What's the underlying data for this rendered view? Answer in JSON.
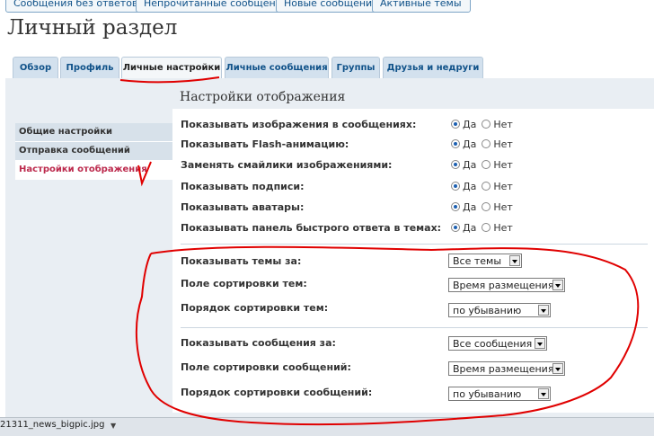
{
  "top_links": [
    "Сообщения без ответов",
    "Непрочитанные сообщения",
    "Новые сообщения",
    "Активные темы"
  ],
  "page_title": "Личный раздел",
  "tabs": [
    "Обзор",
    "Профиль",
    "Личные настройки",
    "Личные сообщения",
    "Группы",
    "Друзья и недруги"
  ],
  "active_tab": "Личные настройки",
  "section_title": "Настройки отображения",
  "side_menu": [
    "Общие настройки",
    "Отправка сообщений",
    "Настройки отображения"
  ],
  "active_side_item": "Настройки отображения",
  "yes_label": "Да",
  "no_label": "Нет",
  "radio_rows": [
    {
      "label": "Показывать изображения в сообщениях:",
      "value": "Да"
    },
    {
      "label": "Показывать Flash-анимацию:",
      "value": "Да"
    },
    {
      "label": "Заменять смайлики изображениями:",
      "value": "Да"
    },
    {
      "label": "Показывать подписи:",
      "value": "Да"
    },
    {
      "label": "Показывать аватары:",
      "value": "Да"
    },
    {
      "label": "Показывать панель быстрого ответа в темах:",
      "value": "Да"
    }
  ],
  "topic_settings": [
    {
      "label": "Показывать темы за:",
      "value": "Все темы"
    },
    {
      "label": "Поле сортировки тем:",
      "value": "Время размещения"
    },
    {
      "label": "Порядок сортировки тем:",
      "value": "по убыванию"
    }
  ],
  "post_settings": [
    {
      "label": "Показывать сообщения за:",
      "value": "Все сообщения"
    },
    {
      "label": "Поле сортировки сообщений:",
      "value": "Время размещения"
    },
    {
      "label": "Порядок сортировки сообщений:",
      "value": "по убыванию"
    }
  ],
  "download_bar": {
    "file_name": "21311_news_bigpic.jpg"
  },
  "colors": {
    "accent": "#105289",
    "active_side": "#bc2a4d",
    "annotation": "#e00000",
    "panel": "#e9eef3"
  }
}
